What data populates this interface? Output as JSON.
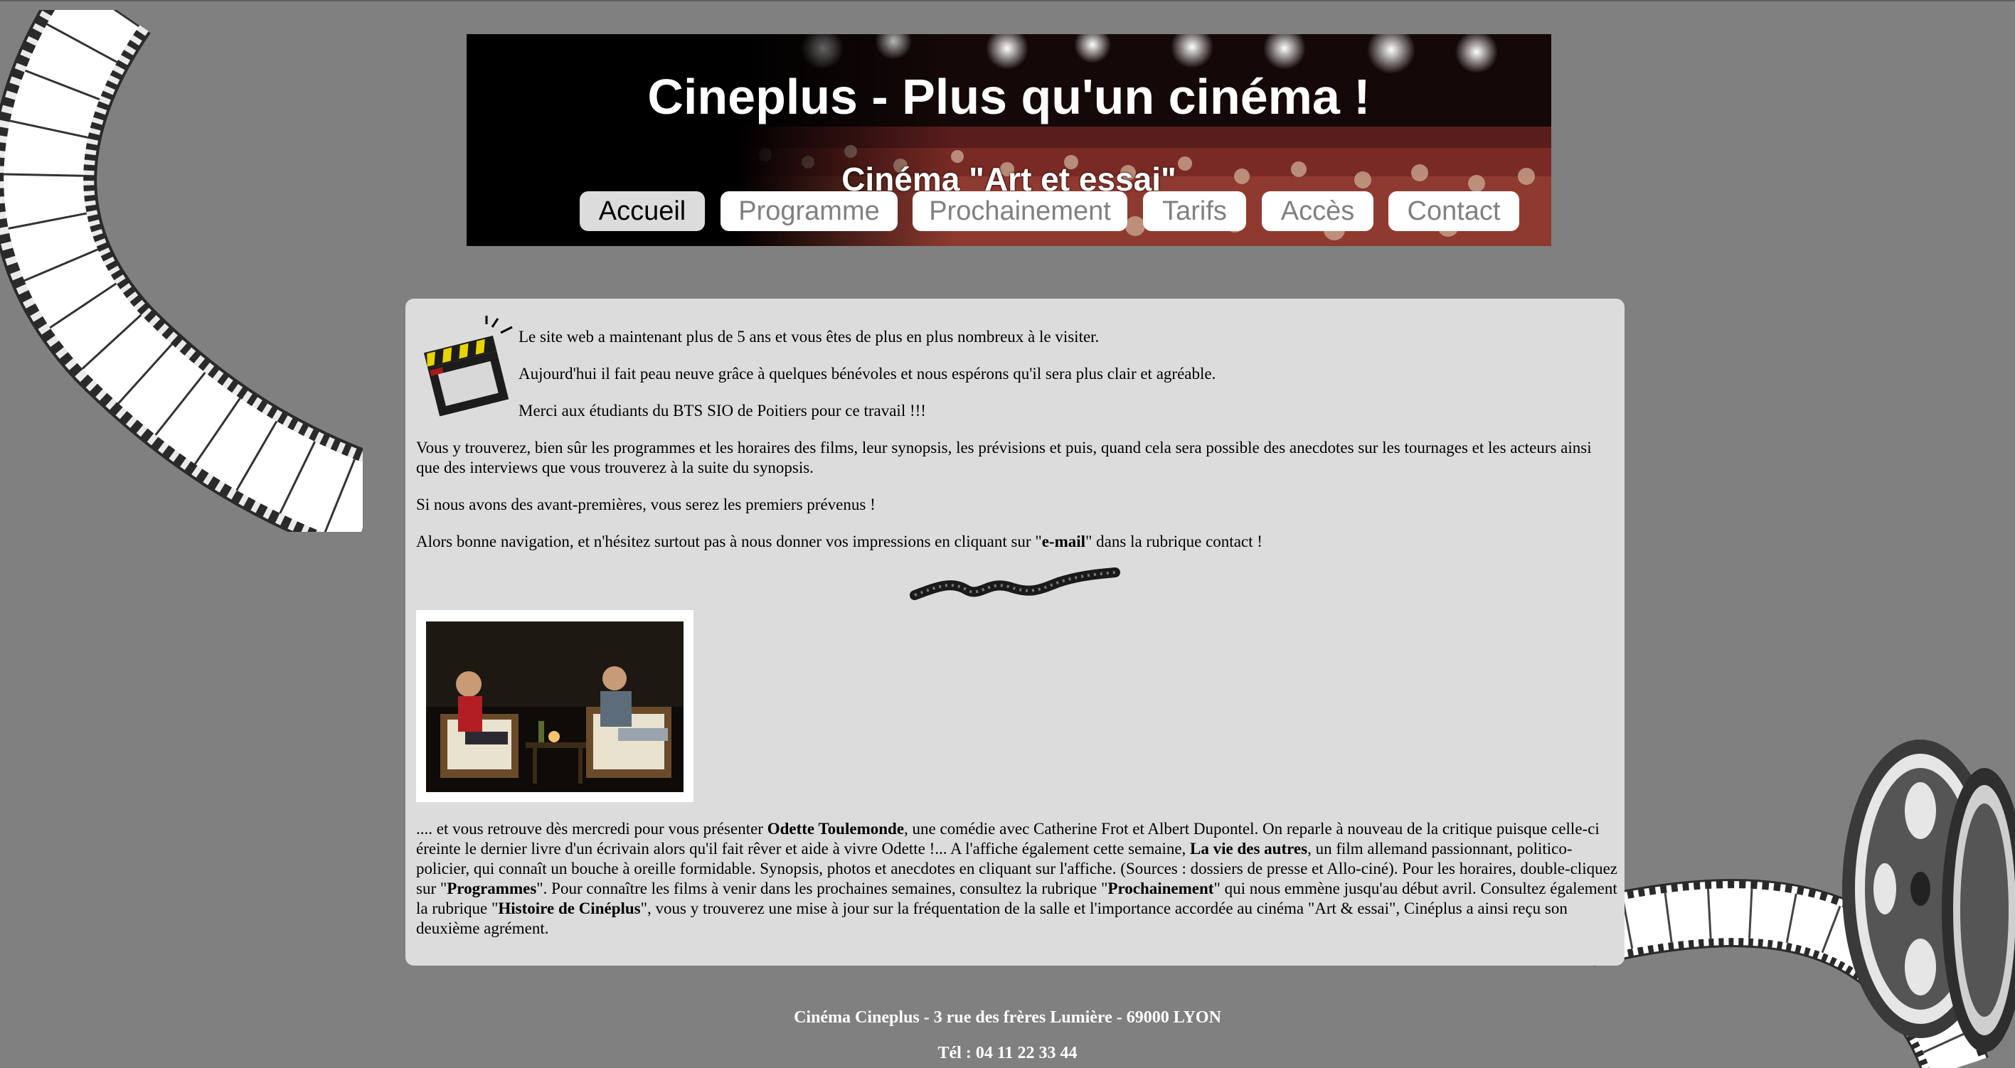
{
  "header": {
    "title": "Cineplus - Plus qu'un cinéma !",
    "subtitle": "Cinéma \"Art et essai\"",
    "nav": [
      {
        "label": "Accueil",
        "active": true
      },
      {
        "label": "Programme",
        "active": false
      },
      {
        "label": "Prochainement",
        "active": false
      },
      {
        "label": "Tarifs",
        "active": false
      },
      {
        "label": "Accès",
        "active": false
      },
      {
        "label": "Contact",
        "active": false
      }
    ]
  },
  "content": {
    "intro": [
      "Le site web a maintenant plus de 5 ans et vous êtes de plus en plus nombreux à le visiter.",
      "Aujourd'hui il fait peau neuve grâce à quelques bénévoles et nous espérons qu'il sera plus clair et agréable.",
      "Merci aux étudiants du BTS SIO de Poitiers pour ce travail !!!"
    ],
    "paragraph_find": "Vous y trouverez, bien sûr les programmes et les horaires des films, leur synopsis, les prévisions et puis, quand cela sera possible des anecdotes sur les tournages et les acteurs ainsi que des interviews que vous trouverez à la suite du synopsis.",
    "paragraph_premiere": "Si nous avons des avant-premières, vous serez les premiers prévenus !",
    "paragraph_nav": {
      "before": "Alors bonne navigation, et n'hésitez surtout pas à nous donner vos impressions en cliquant sur \"",
      "link": "e-mail",
      "after": "\" dans la rubrique contact !"
    },
    "article": {
      "t1": ".... et vous retrouve dès mercredi pour vous présenter ",
      "b1": "Odette Toulemonde",
      "t2": ", une comédie avec Catherine Frot et Albert Dupontel. On reparle à nouveau de la critique puisque celle-ci éreinte le dernier livre d'un écrivain alors qu'il fait rêver et aide à vivre Odette !... A l'affiche également cette semaine, ",
      "b2": "La vie des autres",
      "t3": ", un film allemand passionnant, politico-policier, qui connaît un bouche à oreille formidable. Synopsis, photos et anecdotes en cliquant sur l'affiche. (Sources : dossiers de presse et Allo-ciné). Pour les horaires, double-cliquez sur \"",
      "b3": "Programmes",
      "t4": "\". Pour connaître les films à venir dans les prochaines semaines, consultez  la rubrique \"",
      "b4": "Prochainement",
      "t5": "\" qui nous emmène jusqu'au début avril. Consultez également la rubrique \"",
      "b5": "Histoire de Cinéplus",
      "t6": "\", vous y trouverez une mise à jour sur la fréquentation de la salle et  l'importance accordée au cinéma \"Art & essai\", Cinéplus a ainsi reçu son deuxième agrément."
    }
  },
  "footer": {
    "address": "Cinéma Cineplus - 3 rue des frères Lumière - 69000 LYON",
    "phone": "Tél : 04 11 22 33 44"
  },
  "colors": {
    "page_background": "#808080",
    "panel_background": "#dcdcdc",
    "nav_active_background": "#dcdcdc",
    "nav_inactive_text": "#808080"
  },
  "icons": {
    "clapperboard": "clapperboard-icon",
    "film_strip": "film-strip-decoration",
    "film_reel": "film-reel-decoration"
  }
}
